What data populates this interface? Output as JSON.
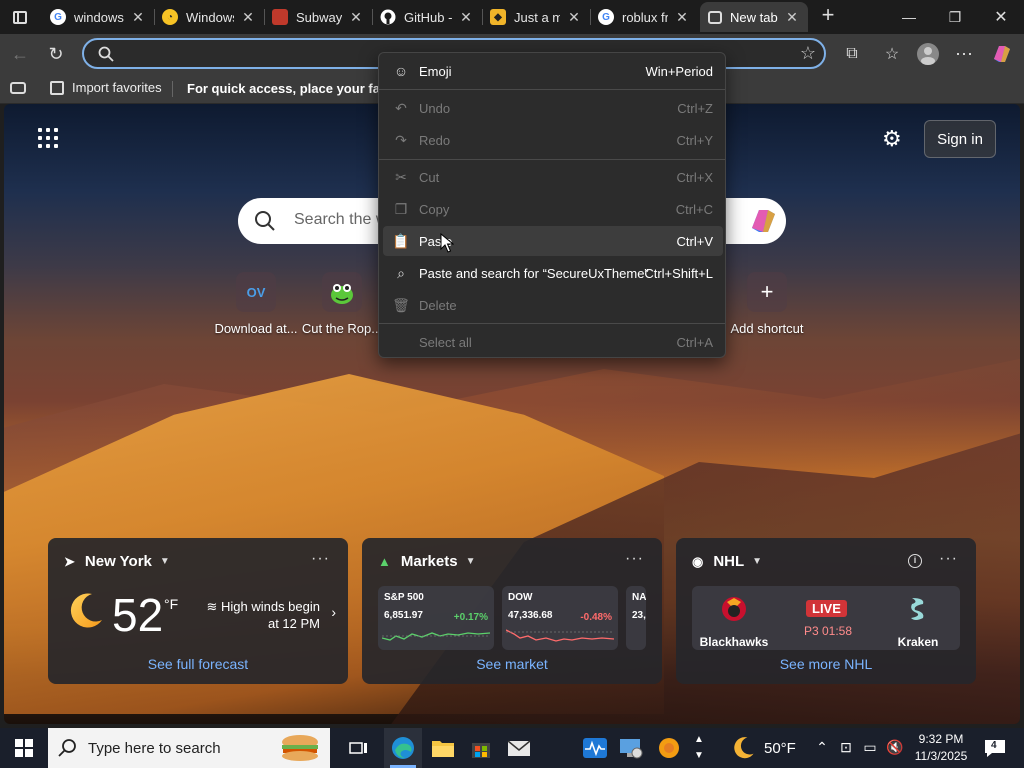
{
  "tabs": [
    {
      "label": "windows",
      "favicon": "google-icon"
    },
    {
      "label": "Windows",
      "favicon": "emoji-glasses-icon"
    },
    {
      "label": "Subway S",
      "favicon": "subway-game-icon"
    },
    {
      "label": "GitHub -",
      "favicon": "github-icon"
    },
    {
      "label": "Just a m",
      "favicon": "cloud-icon"
    },
    {
      "label": "roblux fr",
      "favicon": "google-icon"
    },
    {
      "label": "New tab",
      "favicon": "newtab-icon",
      "active": true
    }
  ],
  "address": {
    "value": "",
    "placeholder": ""
  },
  "favorites_bar": {
    "import_label": "Import favorites",
    "hint": "For quick access, place your favorites here"
  },
  "context_menu": {
    "items": [
      {
        "label": "Emoji",
        "shortcut": "Win+Period",
        "icon": "emoji-icon",
        "enabled": true
      },
      {
        "label": "Undo",
        "shortcut": "Ctrl+Z",
        "icon": "undo-icon",
        "enabled": false
      },
      {
        "label": "Redo",
        "shortcut": "Ctrl+Y",
        "icon": "redo-icon",
        "enabled": false
      },
      {
        "label": "Cut",
        "shortcut": "Ctrl+X",
        "icon": "scissors-icon",
        "enabled": false
      },
      {
        "label": "Copy",
        "shortcut": "Ctrl+C",
        "icon": "copy-icon",
        "enabled": false
      },
      {
        "label": "Paste",
        "shortcut": "Ctrl+V",
        "icon": "paste-icon",
        "enabled": true
      },
      {
        "label": "Paste and search for “SecureUxTheme”",
        "shortcut": "Ctrl+Shift+L",
        "icon": "paste-search-icon",
        "enabled": true
      },
      {
        "label": "Delete",
        "shortcut": "",
        "icon": "trash-icon",
        "enabled": false
      },
      {
        "label": "Select all",
        "shortcut": "Ctrl+A",
        "icon": "",
        "enabled": false
      }
    ]
  },
  "newtab": {
    "signin_label": "Sign in",
    "search_placeholder": "Search the web",
    "shortcuts": [
      {
        "label": "Download at...",
        "tile": "OV"
      },
      {
        "label": "Cut the Rop...",
        "tile": ""
      },
      {
        "label": "Add shortcut",
        "tile": "+"
      }
    ]
  },
  "weather": {
    "location": "New York",
    "temp": "52",
    "unit": "°F",
    "alert": "High winds begin at 12 PM",
    "link": "See full forecast"
  },
  "markets": {
    "title": "Markets",
    "link": "See market",
    "stocks": [
      {
        "name": "S&P 500",
        "value": "6,851.97",
        "change": "+0.17%",
        "color": "#5bd16b"
      },
      {
        "name": "DOW",
        "value": "47,336.68",
        "change": "-0.48%",
        "color": "#ff6b6b"
      },
      {
        "name": "NA",
        "value": "23,",
        "change": "",
        "color": "#5bd16b"
      }
    ]
  },
  "nhl": {
    "title": "NHL",
    "home": "Blackhawks",
    "away": "Kraken",
    "status": "LIVE",
    "period": "P3 01:58",
    "link": "See more NHL"
  },
  "taskbar": {
    "search_placeholder": "Type here to search",
    "weather_temp": "50°F",
    "time": "9:32 PM",
    "date": "11/3/2025",
    "notification_count": "4"
  }
}
